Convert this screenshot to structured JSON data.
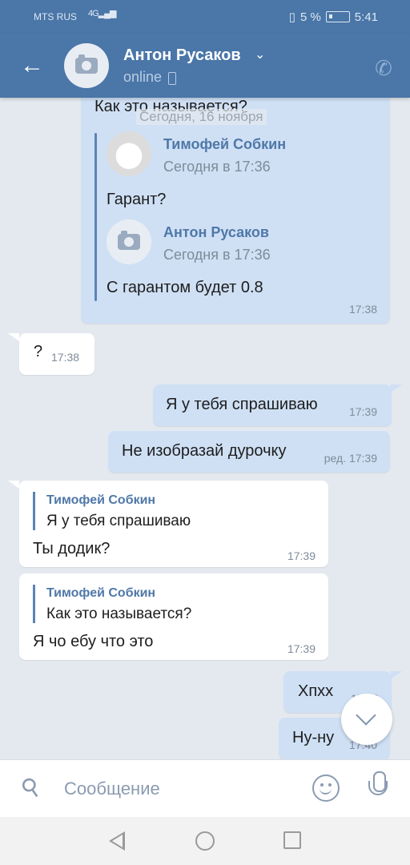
{
  "status_bar": {
    "carrier": "MTS RUS",
    "network": "4G",
    "battery": "5 %",
    "time": "5:41"
  },
  "header": {
    "name": "Антон Русаков",
    "status": "online"
  },
  "chat": {
    "date_separator": "Сегодня, 16 ноября",
    "top_fragment": "Как это называется?",
    "forwarded": [
      {
        "name": "Тимофей Собкин",
        "date": "Сегодня в 17:36",
        "text": "Гарант?"
      },
      {
        "name": "Антон Русаков",
        "date": "Сегодня в 17:36",
        "text": "С гарантом будет 0.8"
      }
    ],
    "forwarded_time": "17:38",
    "messages": [
      {
        "text": "?",
        "time": "17:38",
        "direction": "in"
      },
      {
        "text": "Я у тебя спрашиваю",
        "time": "17:39",
        "direction": "out"
      },
      {
        "text": "Не изобразай дурочку",
        "time": "ред. 17:39",
        "direction": "out"
      },
      {
        "quote_name": "Тимофей Собкин",
        "quote_text": "Я у тебя спрашиваю",
        "text": "Ты додик?",
        "time": "17:39",
        "direction": "in"
      },
      {
        "quote_name": "Тимофей Собкин",
        "quote_text": "Как это называется?",
        "text": "Я чо ебу что это",
        "time": "17:39",
        "direction": "in"
      },
      {
        "text": "Хпхх",
        "time": "17:40",
        "direction": "out"
      },
      {
        "text": "Ну-ну",
        "time": "17:40",
        "direction": "out"
      }
    ]
  },
  "input": {
    "placeholder": "Сообщение"
  },
  "colors": {
    "accent": "#4a76a8",
    "outgoing_bubble": "#cfe0f5",
    "incoming_bubble": "#ffffff",
    "background": "#e4e9ef"
  }
}
